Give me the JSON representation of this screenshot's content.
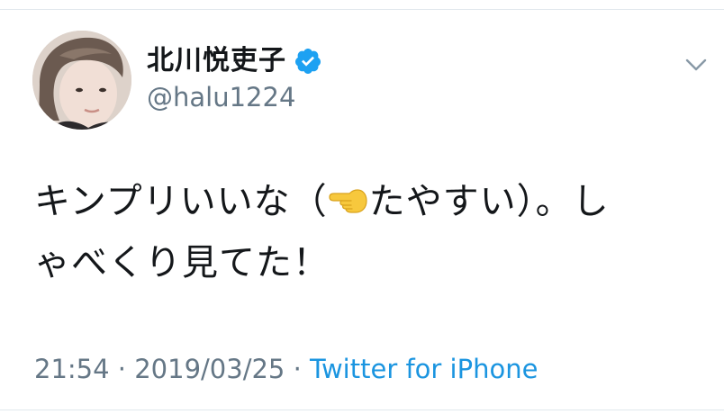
{
  "user": {
    "display_name": "北川悦吏子",
    "handle": "@halu1224",
    "verified": true
  },
  "tweet": {
    "text_line1_a": "キンプリいいな（",
    "emoji": "backhand-index-pointing-left",
    "text_line1_b": "たやすい）。し",
    "text_line2": "ゃべくり見てた！",
    "time": "21:54",
    "separator": " · ",
    "date": "2019/03/25",
    "source": "Twitter for iPhone"
  },
  "colors": {
    "verified_badge": "#1da1f2",
    "link": "#1b95e0",
    "secondary_text": "#657786"
  }
}
